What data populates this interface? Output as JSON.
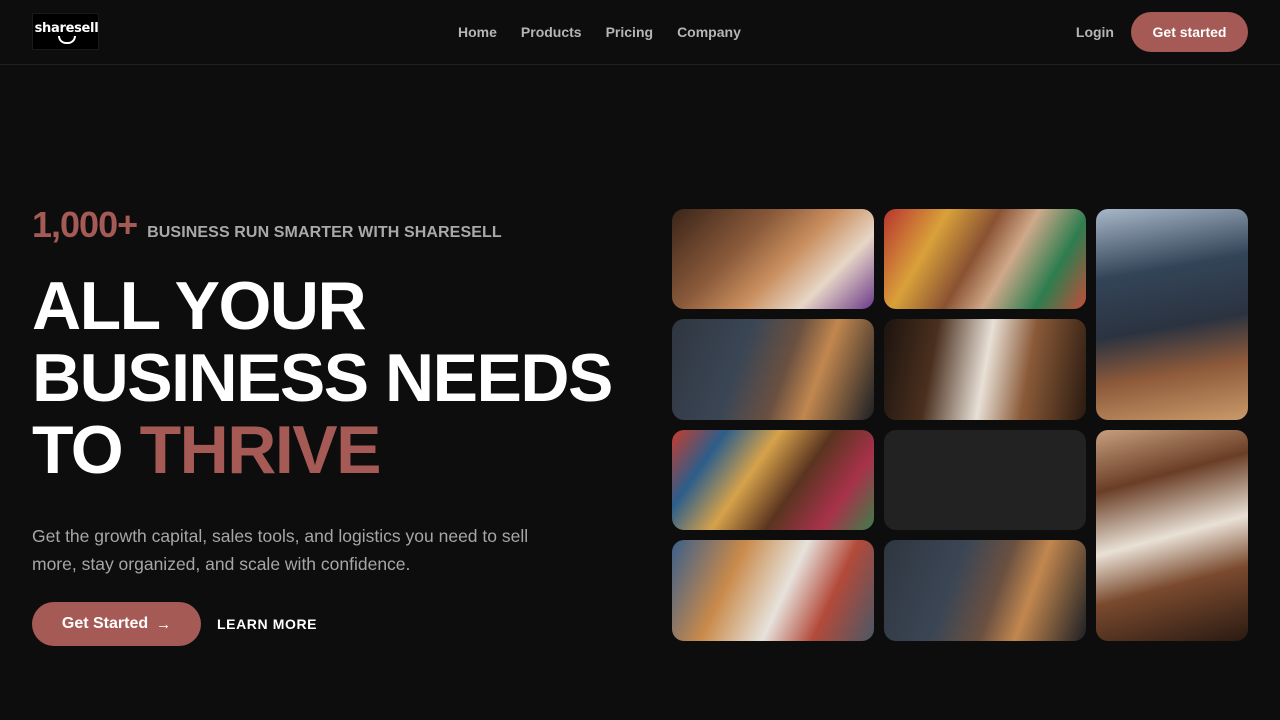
{
  "header": {
    "logo_text": "sharesell",
    "nav": [
      "Home",
      "Products",
      "Pricing",
      "Company"
    ],
    "login_label": "Login",
    "cta_label": "Get started"
  },
  "hero": {
    "stat_number": "1,000+",
    "stat_label": "BUSINESS RUN SMARTER WITH SHARESELL",
    "headline_line1": "ALL YOUR",
    "headline_line2": "BUSINESS NEEDS",
    "headline_line3_plain": "TO ",
    "headline_line3_accent": "THRIVE",
    "subtitle": "Get the growth capital, sales tools, and logistics you need to sell more, stay organized, and scale with confidence.",
    "primary_cta": "Get Started",
    "secondary_cta": "LEARN MORE"
  },
  "colors": {
    "accent": "#a55a56",
    "background": "#0d0d0d"
  },
  "gallery": {
    "tiles": [
      "photo",
      "photo",
      "photo",
      "photo",
      "photo",
      "photo",
      "placeholder",
      "photo",
      "photo",
      "photo"
    ]
  }
}
